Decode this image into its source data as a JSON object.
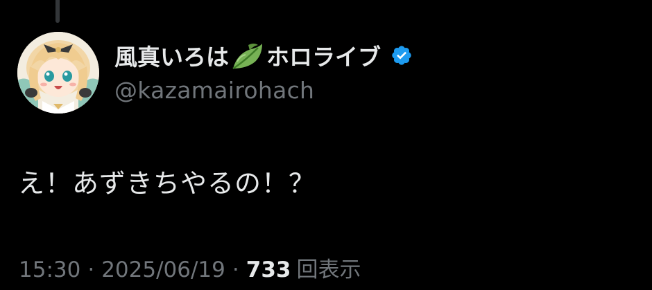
{
  "tweet": {
    "display_name": "風真いろは",
    "name_suffix": "ホロライブ",
    "name_emoji": "leaf-emoji",
    "verified_badge": "verified-badge-icon",
    "handle": "@kazamairohach",
    "text": "え！あずきちやるの！？",
    "time": "15:30",
    "separator": "·",
    "date": "2025/06/19",
    "views_count": "733",
    "views_label": "回表示"
  },
  "colors": {
    "background": "#000000",
    "primary_text": "#e7e9ea",
    "secondary_text": "#71767b",
    "verified_blue": "#1d9bf0",
    "thread_line": "#333639"
  }
}
